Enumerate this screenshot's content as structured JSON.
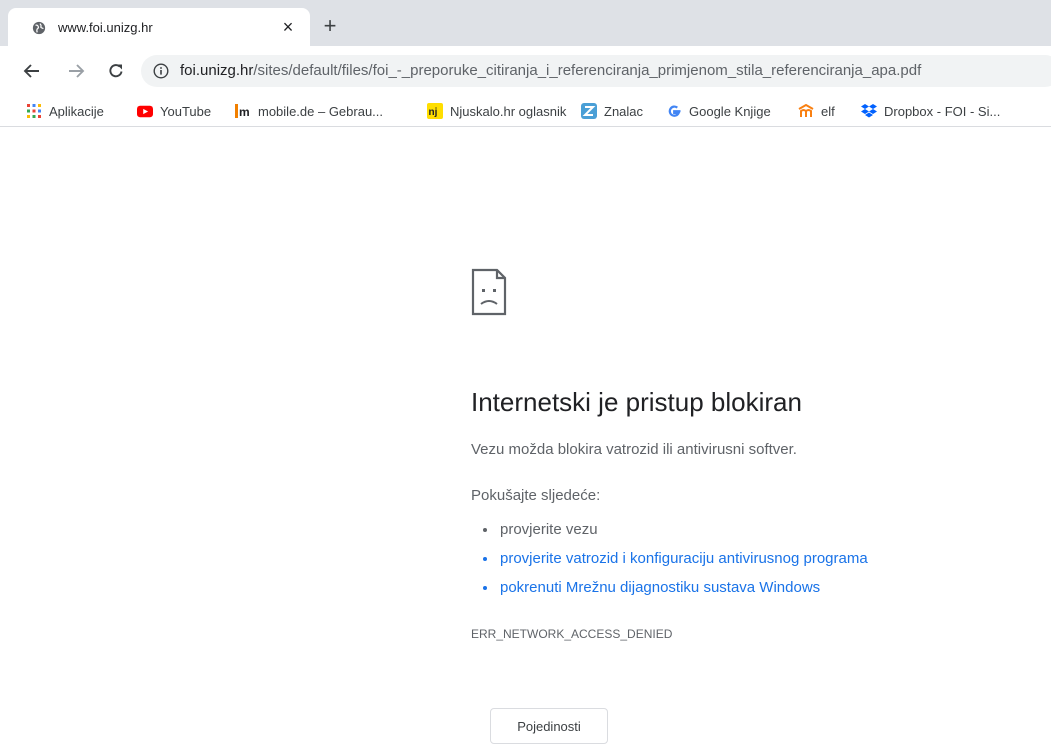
{
  "tab": {
    "title": "www.foi.unizg.hr",
    "favicon": "globe-icon",
    "close_label": "×"
  },
  "new_tab_label": "+",
  "toolbar": {
    "back_icon": "arrow-left-icon",
    "forward_icon": "arrow-right-icon",
    "reload_icon": "reload-icon",
    "info_icon": "info-circle-icon"
  },
  "omnibox": {
    "host": "foi.unizg.hr",
    "path": "/sites/default/files/foi_-_preporuke_citiranja_i_referenciranja_primjenom_stila_referenciranja_apa.pdf"
  },
  "bookmarks": [
    {
      "label": "Aplikacije",
      "icon": "apps-grid-icon"
    },
    {
      "label": "YouTube",
      "icon": "youtube-icon"
    },
    {
      "label": "mobile.de – Gebrau...",
      "icon": "mobile-de-icon"
    },
    {
      "label": "Njuskalo.hr oglasnik",
      "icon": "njuskalo-icon"
    },
    {
      "label": "Znalac",
      "icon": "znalac-icon"
    },
    {
      "label": "Google Knjige",
      "icon": "google-icon"
    },
    {
      "label": "elf",
      "icon": "moodle-icon"
    },
    {
      "label": "Dropbox - FOI - Si...",
      "icon": "dropbox-icon"
    }
  ],
  "error": {
    "icon": "sad-document-icon",
    "title": "Internetski je pristup blokiran",
    "description": "Vezu možda blokira vatrozid ili antivirusni softver.",
    "try_heading": "Pokušajte sljedeće:",
    "suggestions": [
      "provjerite vezu",
      "provjerite vatrozid i konfiguraciju antivirusnog programa",
      "pokrenuti Mrežnu dijagnostiku sustava Windows"
    ],
    "code": "ERR_NETWORK_ACCESS_DENIED",
    "details_label": "Pojedinosti"
  },
  "colors": {
    "link": "#1a73e8",
    "text": "#5f6368",
    "heading": "#202124",
    "tabstrip": "#dee1e6"
  }
}
